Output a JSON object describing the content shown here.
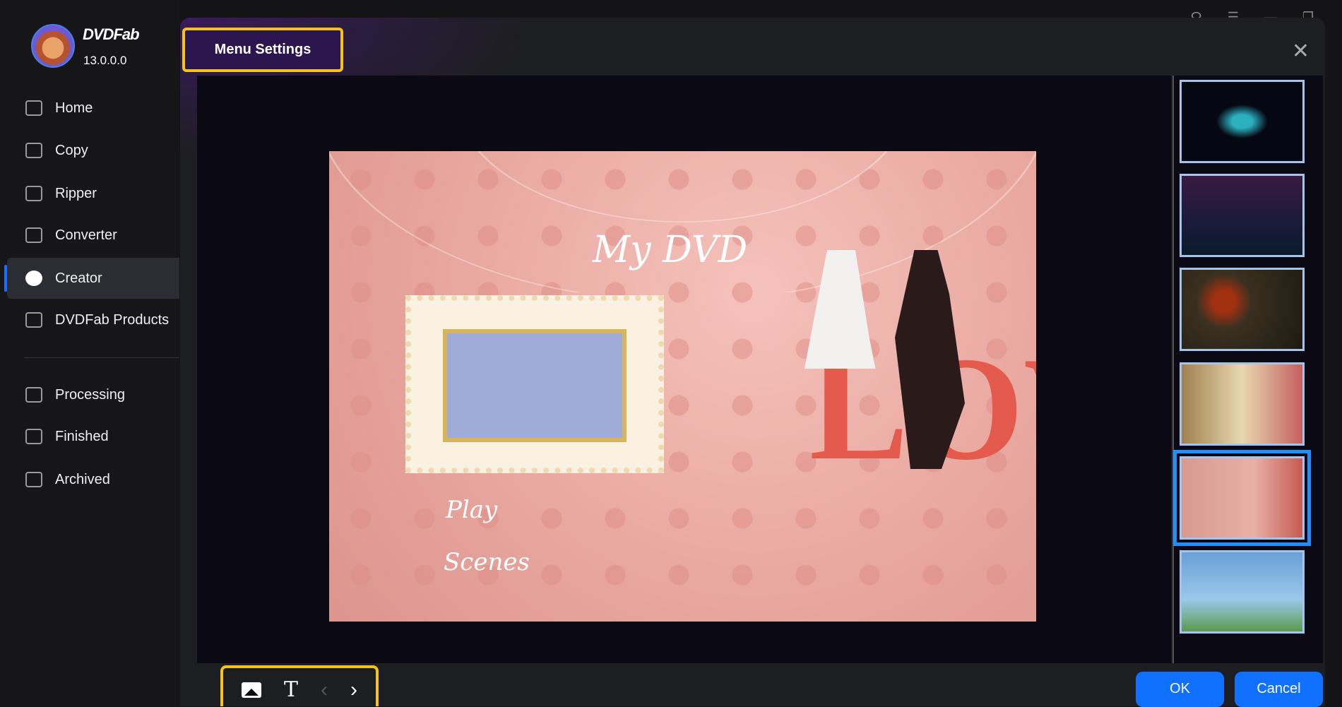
{
  "app": {
    "brand": "DVDFab",
    "version": "13.0.0.0"
  },
  "sidebar": {
    "items": [
      {
        "label": "Home",
        "icon": "home-icon"
      },
      {
        "label": "Copy",
        "icon": "copy-icon"
      },
      {
        "label": "Ripper",
        "icon": "ripper-icon"
      },
      {
        "label": "Converter",
        "icon": "converter-icon"
      },
      {
        "label": "Creator",
        "icon": "creator-icon",
        "active": true
      },
      {
        "label": "DVDFab Products",
        "icon": "products-icon"
      },
      {
        "label": "Processing",
        "icon": "processing-icon"
      },
      {
        "label": "Finished",
        "icon": "finished-icon"
      },
      {
        "label": "Archived",
        "icon": "archived-icon"
      }
    ]
  },
  "dialog": {
    "title": "Menu Settings",
    "ok": "OK",
    "cancel": "Cancel"
  },
  "preview": {
    "title_text": "My DVD",
    "play": "Play",
    "scenes": "Scenes",
    "love": "LOVE"
  },
  "toolbar": {
    "text_tool": "T",
    "prev": "‹",
    "next": "›"
  },
  "thumbnails": [
    {
      "theme": "dark-tech",
      "selected": false
    },
    {
      "theme": "night-sky",
      "selected": false
    },
    {
      "theme": "film-reel",
      "selected": false
    },
    {
      "theme": "birthday",
      "selected": false
    },
    {
      "theme": "wedding-love",
      "selected": true
    },
    {
      "theme": "kids-rainbow",
      "selected": false
    }
  ],
  "colors": {
    "accent": "#f7c316",
    "primary": "#1070ff",
    "selected": "#1e8fff"
  }
}
